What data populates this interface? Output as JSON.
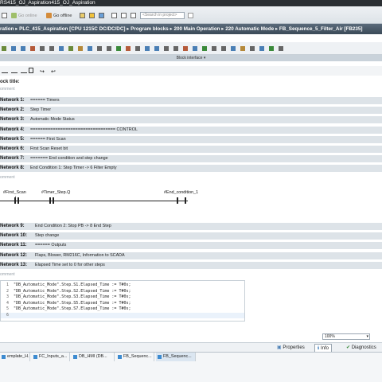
{
  "title": "RS415_OJ_Aspiration415_OJ_Aspiration",
  "toolbar": {
    "go_online": "Go online",
    "go_offline": "Go offline",
    "search_placeholder": "<Search in project>"
  },
  "breadcrumb": [
    "ration",
    "PLC_415_Aspiration [CPU 1215C DC/DC/DC]",
    "Program blocks",
    "200 Main Operation",
    "220 Automatic Mode",
    "FB_Sequence_5_Filter_Air [FB235]"
  ],
  "block_interface_label": "Block interface",
  "block_title_label": "ock title:",
  "comment_label": "omment",
  "networks_top": [
    {
      "name": "Network 1:",
      "title": "====== Timers"
    },
    {
      "name": "Network 2:",
      "title": "Step Timer"
    },
    {
      "name": "Network 3:",
      "title": "Automatic Mode Status"
    },
    {
      "name": "Network 4:",
      "title": "================================== CONTROL"
    },
    {
      "name": "Network 5:",
      "title": "====== First Scan"
    },
    {
      "name": "Network 6:",
      "title": "First Scan Reset bit"
    },
    {
      "name": "Network 7:",
      "title": "======= End condition and step change"
    },
    {
      "name": "Network 8:",
      "title": "End Condition 1: Step Timer -> 6 Filter Empty"
    }
  ],
  "ladder": {
    "contact1": "#First_Scan",
    "contact2": "#Timer_Step.Q",
    "coil": "#End_condition_1"
  },
  "networks_bottom": [
    {
      "name": "Network 9:",
      "title": "End Condition 2: Stop PB -> 8 End Step"
    },
    {
      "name": "Network 10:",
      "title": "Step change"
    },
    {
      "name": "Network 11:",
      "title": "====== Outputs"
    },
    {
      "name": "Network 12:",
      "title": "Flaps, Blower, RM216C, Information to SCADA"
    },
    {
      "name": "Network 13:",
      "title": "Elapsed Time set to 0 for other steps"
    }
  ],
  "scl_lines": [
    {
      "num": "1",
      "code": "\"DB_Automatic_Mode\".Step.S1.Elapsed_Time := T#0s;"
    },
    {
      "num": "2",
      "code": "\"DB_Automatic_Mode\".Step.S2.Elapsed_Time := T#0s;"
    },
    {
      "num": "3",
      "code": "\"DB_Automatic_Mode\".Step.S3.Elapsed_Time := T#0s;"
    },
    {
      "num": "4",
      "code": "\"DB_Automatic_Mode\".Step.S5.Elapsed_Time := T#0s;"
    },
    {
      "num": "5",
      "code": "\"DB_Automatic_Mode\".Step.S7.Elapsed_Time := T#0s;"
    },
    {
      "num": "6",
      "code": ""
    }
  ],
  "zoom": "100%",
  "inspector_tabs": [
    "Properties",
    "Info",
    "Diagnostics"
  ],
  "taskbar": [
    "emplate_H...",
    "FC_Inputs_a...",
    "DB_HMI (DB...",
    "FB_Sequenc...",
    "FB_Sequenc..."
  ],
  "colors": {
    "title_bar": "#2b2f33",
    "breadcrumb": "#3b4a58",
    "network_header": "#dde3e8"
  }
}
